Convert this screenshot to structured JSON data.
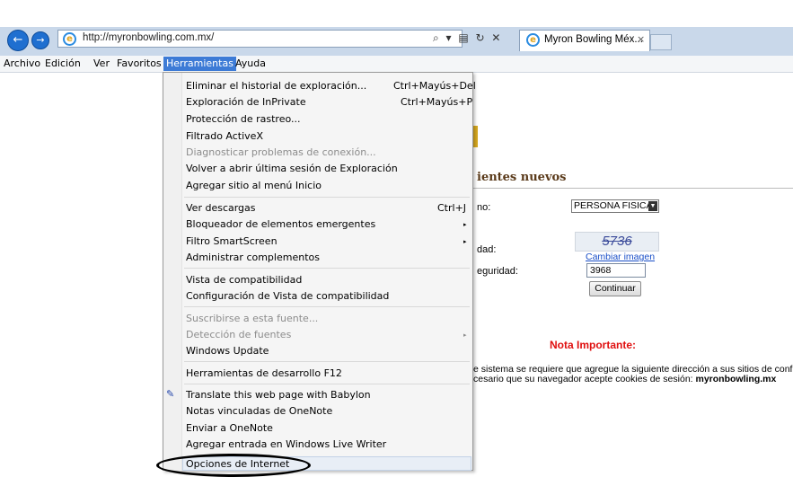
{
  "browser": {
    "url": "http://myronbowling.com.mx/",
    "tab_title": "Myron Bowling Méx...",
    "tab_close": "×",
    "back_glyph": "←",
    "forward_glyph": "→",
    "address_icons": "⌕ ▾ ▤ ↻ ✕",
    "ie_logo": "e"
  },
  "menubar": {
    "archivo": "Archivo",
    "edicion": "Edición",
    "ver": "Ver",
    "favoritos": "Favoritos",
    "herramientas": "Herramientas",
    "ayuda": "Ayuda"
  },
  "menu": {
    "eliminar": "Eliminar el historial de exploración...",
    "eliminar_sc": "Ctrl+Mayús+Del",
    "inprivate": "Exploración de InPrivate",
    "inprivate_sc": "Ctrl+Mayús+P",
    "rastreo": "Protección de rastreo...",
    "activex": "Filtrado ActiveX",
    "diagnosticar": "Diagnosticar problemas de conexión...",
    "reabrir": "Volver a abrir última sesión de Exploración",
    "agregar_inicio": "Agregar sitio al menú Inicio",
    "descargas": "Ver descargas",
    "descargas_sc": "Ctrl+J",
    "bloqueador": "Bloqueador de elementos emergentes",
    "smartscreen": "Filtro SmartScreen",
    "complementos": "Administrar complementos",
    "compat": "Vista de compatibilidad",
    "compat_config": "Configuración de Vista de compatibilidad",
    "suscribirse": "Suscribirse a esta fuente...",
    "deteccion": "Detección de fuentes",
    "windows_update": "Windows Update",
    "desarrollo": "Herramientas de desarrollo F12",
    "babylon": "Translate this web page with Babylon",
    "onenote_notas": "Notas vinculadas de OneNote",
    "onenote_enviar": "Enviar a OneNote",
    "live_writer": "Agregar entrada en Windows Live Writer",
    "opciones": "Opciones de Internet",
    "submenu_arrow": "▸"
  },
  "page": {
    "heading": "ientes nuevos",
    "label_tipo": "no:",
    "select_value": "PERSONA FISICA",
    "label_seguridad": "dad:",
    "captcha_text": "5736",
    "cambiar_imagen": "Cambiar imagen",
    "label_codigo": "eguridad:",
    "code_value": "3968",
    "continuar": "Continuar",
    "nota_title": "Nota Importante:",
    "msg_line1": "e sistema se requiere que agregue la siguiente dirección a sus sitios de confianza",
    "msg_line2_prefix": "cesario que su navegador acepte cookies de sesión: ",
    "msg_line2_domain": "myronbowling.mx"
  },
  "colors": {
    "accent": "#3d7bd6",
    "warning": "#e01010",
    "link": "#1a4fc8"
  }
}
